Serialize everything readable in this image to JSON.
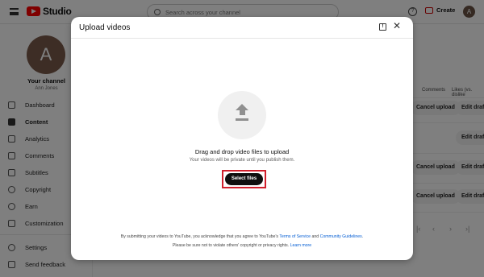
{
  "app": {
    "logo_text": "Studio",
    "search_placeholder": "Search across your channel",
    "create_label": "Create",
    "avatar_initial": "A"
  },
  "sidebar": {
    "avatar_initial": "A",
    "channel_title": "Your channel",
    "channel_owner": "Ann Jones",
    "items": [
      {
        "label": "Dashboard",
        "icon": "dashboard-icon"
      },
      {
        "label": "Content",
        "icon": "content-icon",
        "active": true
      },
      {
        "label": "Analytics",
        "icon": "analytics-icon"
      },
      {
        "label": "Comments",
        "icon": "comments-icon"
      },
      {
        "label": "Subtitles",
        "icon": "subtitles-icon"
      },
      {
        "label": "Copyright",
        "icon": "copyright-icon"
      },
      {
        "label": "Earn",
        "icon": "earn-icon"
      },
      {
        "label": "Customization",
        "icon": "customization-icon"
      },
      {
        "label": "Settings",
        "icon": "settings-icon"
      },
      {
        "label": "Send feedback",
        "icon": "feedback-icon"
      }
    ]
  },
  "content_table": {
    "headers": [
      "Comments",
      "Likes (vs. dislike"
    ],
    "cancel_upload_label": "Cancel upload",
    "edit_draft_label": "Edit draft"
  },
  "upload_dialog": {
    "title": "Upload videos",
    "drag_text": "Drag and drop video files to upload",
    "private_note": "Your videos will be private until you publish them.",
    "select_files_label": "Select files",
    "terms_prefix": "By submitting your videos to YouTube, you acknowledge that you agree to YouTube's",
    "terms_link": "Terms of Service",
    "terms_and": "and",
    "guidelines_link": "Community Guidelines",
    "rights_text": "Please be sure not to violate others' copyright or privacy rights.",
    "learn_more": "Learn more"
  },
  "colors": {
    "accent_red": "#ff0000",
    "highlight_box": "#d11f2c",
    "link_blue": "#065fd4"
  }
}
